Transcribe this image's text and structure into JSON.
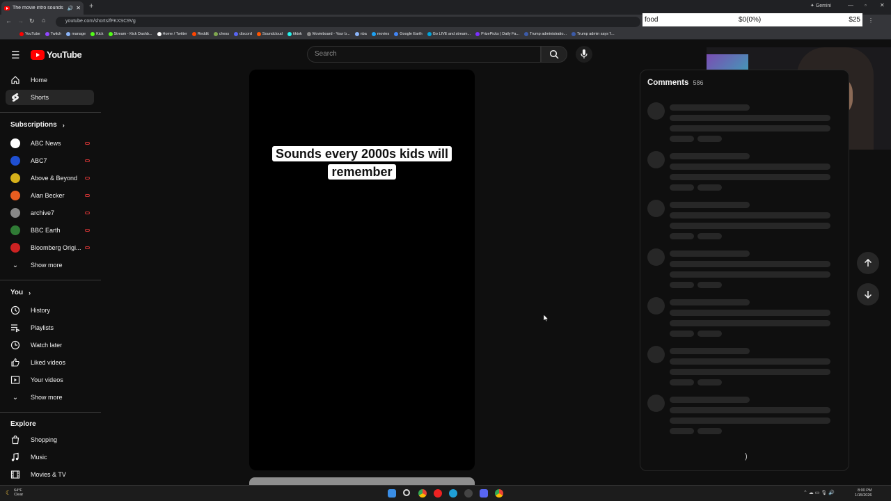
{
  "browser": {
    "tab_title": "The movie intro sounds are...",
    "gemini_label": "Gemini",
    "url": "youtube.com/shorts/fFKXSC9Vg",
    "bookmarks": [
      "YouTube",
      "Twitch",
      "manage",
      "Kick",
      "Stream - Kick Dashb...",
      "Home / Twitter",
      "Reddit",
      "chess",
      "discord",
      "Soundcloud",
      "tiktok",
      "Movieboard - Your b...",
      "nba",
      "movies",
      "Google Earth",
      "Go LIVE and stream...",
      "PrizePicks | Daily Fa...",
      "Trump administratio...",
      "Trump admin says 'I..."
    ]
  },
  "overlay": {
    "label": "food",
    "progress": "$0(0%)",
    "goal": "$25"
  },
  "header": {
    "logo_text": "YouTube",
    "search_placeholder": "Search"
  },
  "sidebar": {
    "top": [
      {
        "label": "Home",
        "icon": "home-icon"
      },
      {
        "label": "Shorts",
        "icon": "shorts-icon",
        "active": true
      }
    ],
    "subscriptions_heading": "Subscriptions",
    "channels": [
      {
        "label": "ABC News",
        "color": "#ffffff"
      },
      {
        "label": "ABC7",
        "color": "#1f4fd1"
      },
      {
        "label": "Above & Beyond",
        "color": "#d6b11a"
      },
      {
        "label": "Alan Becker",
        "color": "#e85d20"
      },
      {
        "label": "archive7",
        "color": "#888888"
      },
      {
        "label": "BBC Earth",
        "color": "#2f7b35"
      },
      {
        "label": "Bloomberg Origi...",
        "color": "#cc2222"
      }
    ],
    "show_more": "Show more",
    "you_heading": "You",
    "you_items": [
      {
        "label": "History",
        "icon": "history-icon"
      },
      {
        "label": "Playlists",
        "icon": "playlists-icon"
      },
      {
        "label": "Watch later",
        "icon": "watch-later-icon"
      },
      {
        "label": "Liked videos",
        "icon": "liked-icon"
      },
      {
        "label": "Your videos",
        "icon": "your-videos-icon"
      }
    ],
    "show_more_2": "Show more",
    "explore_heading": "Explore",
    "explore_items": [
      {
        "label": "Shopping",
        "icon": "shopping-icon"
      },
      {
        "label": "Music",
        "icon": "music-icon"
      },
      {
        "label": "Movies & TV",
        "icon": "movies-icon"
      }
    ]
  },
  "video": {
    "caption": "Sounds every 2000s kids will remember"
  },
  "comments": {
    "title": "Comments",
    "count": "586"
  },
  "taskbar": {
    "temp": "64°F",
    "condition": "Clear",
    "time": "8:00 PM",
    "date": "1/15/2026"
  }
}
